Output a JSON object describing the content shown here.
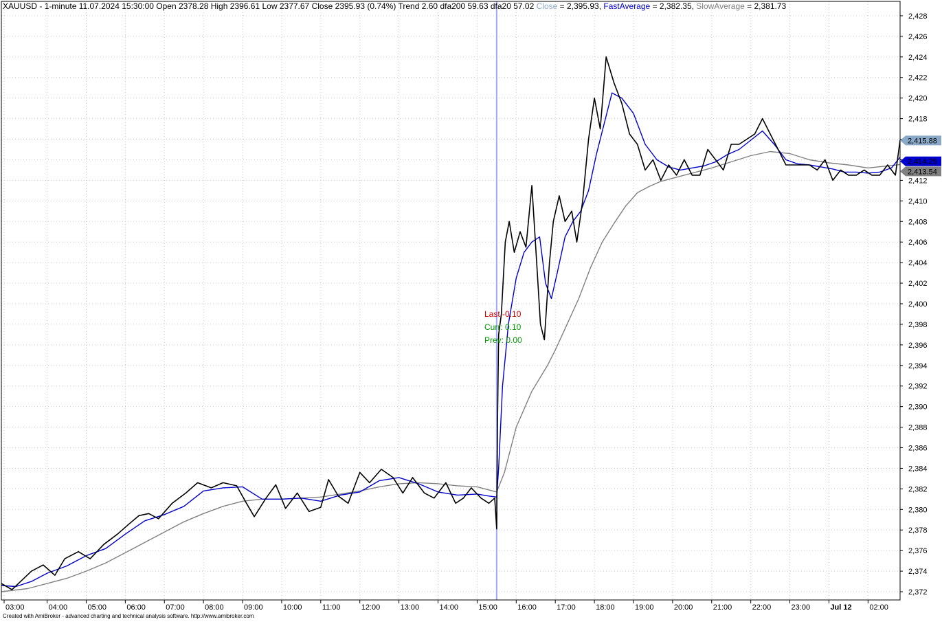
{
  "header": {
    "symbol": "XAUUSD",
    "interval": "1-minute",
    "datetime": "11.07.2024 15:30:00",
    "open_label": "Open",
    "open": "2378.28",
    "high_label": "High",
    "high": "2396.61",
    "low_label": "Low",
    "low": "2377.67",
    "close_label": "Close",
    "close": "2395.93",
    "change": "(0.74%)",
    "trend_label": "Trend",
    "trend": "2.60",
    "dfa200_label": "dfa200",
    "dfa200": "59.63",
    "dfa20_label": "dfa20",
    "dfa20": "57.02",
    "ind_close_label": "Close",
    "ind_close_value": "= 2,395.93",
    "ind_fast_label": "FastAverage",
    "ind_fast_value": "= 2,382.35",
    "ind_slow_label": "SlowAverage",
    "ind_slow_value": "= 2,381.73"
  },
  "annotations": {
    "last": "Last -0.10",
    "curr": "Curr: 0.10",
    "prev": "Prev: 0.00"
  },
  "footer": "Created with AmiBroker - advanced charting and technical analysis software. http://www.amibroker.com",
  "colors": {
    "price": "#000000",
    "fast": "#0000cc",
    "slow": "#808080",
    "cursor": "#a0a8ff",
    "grid": "#c8c8c8",
    "last_label": "#cc0000",
    "curr_label": "#009900",
    "prev_label": "#009900",
    "close_badge": "#8aa8c8",
    "fast_badge": "#0000cc",
    "slow_badge": "#808080"
  },
  "chart_data": {
    "type": "line",
    "x_tick_labels": [
      "03:00",
      "04:00",
      "05:00",
      "06:00",
      "07:00",
      "08:00",
      "09:00",
      "10:00",
      "11:00",
      "12:00",
      "13:00",
      "14:00",
      "15:00",
      "16:00",
      "17:00",
      "18:00",
      "19:00",
      "20:00",
      "21:00",
      "22:00",
      "23:00",
      "Jul 12",
      "02:00"
    ],
    "x_ticks": [
      2.9,
      4,
      5,
      6,
      7,
      8,
      9,
      10,
      11,
      12,
      13,
      14,
      15,
      16,
      17,
      18,
      19,
      20,
      21,
      22,
      23,
      24,
      25
    ],
    "xlim": [
      2.83,
      25.82
    ],
    "ylim": [
      2371.2,
      2429.4
    ],
    "y_ticks": [
      2372,
      2374,
      2376,
      2378,
      2380,
      2382,
      2384,
      2386,
      2388,
      2390,
      2392,
      2394,
      2396,
      2398,
      2400,
      2402,
      2404,
      2406,
      2408,
      2410,
      2412,
      2414,
      2416,
      2418,
      2420,
      2422,
      2424,
      2426,
      2428
    ],
    "y_tick_labels": [
      "2,372",
      "2,374",
      "2,376",
      "2,378",
      "2,380",
      "2,382",
      "2,384",
      "2,386",
      "2,388",
      "2,390",
      "2,392",
      "2,394",
      "2,396",
      "2,398",
      "2,400",
      "2,402",
      "2,404",
      "2,406",
      "2,408",
      "2,410",
      "2,412",
      "2,414",
      "2,416",
      "2,418",
      "2,420",
      "2,422",
      "2,424",
      "2,426",
      "2,428"
    ],
    "cursor_x": 15.5,
    "last_values": [
      {
        "name": "Close",
        "value": "2,415.88",
        "y": 2415.88
      },
      {
        "name": "FastAverage",
        "value": "2,414.25",
        "y": 2414.25
      },
      {
        "name": "SlowAverage",
        "value": "2,413.54",
        "y": 2413.54
      }
    ],
    "series": [
      {
        "name": "Close",
        "color": "#000000",
        "x": [
          2.83,
          3.1,
          3.35,
          3.6,
          3.9,
          4.2,
          4.45,
          4.8,
          5.1,
          5.45,
          5.8,
          6.1,
          6.35,
          6.6,
          6.85,
          7.2,
          7.55,
          7.85,
          8.2,
          8.5,
          8.85,
          9.1,
          9.3,
          9.6,
          9.85,
          10.1,
          10.4,
          10.7,
          11.0,
          11.2,
          11.45,
          11.7,
          12.0,
          12.25,
          12.55,
          12.85,
          13.1,
          13.35,
          13.65,
          13.9,
          14.2,
          14.45,
          14.65,
          14.85,
          15.1,
          15.3,
          15.45,
          15.5,
          15.52,
          15.55,
          15.62,
          15.72,
          15.82,
          15.95,
          16.1,
          16.25,
          16.4,
          16.5,
          16.62,
          16.72,
          16.85,
          16.95,
          17.1,
          17.25,
          17.42,
          17.55,
          17.7,
          17.85,
          18.0,
          18.15,
          18.3,
          18.5,
          18.7,
          18.9,
          19.1,
          19.3,
          19.5,
          19.7,
          19.9,
          20.1,
          20.3,
          20.5,
          20.7,
          20.9,
          21.1,
          21.3,
          21.5,
          21.7,
          21.9,
          22.1,
          22.3,
          22.5,
          22.7,
          22.9,
          23.1,
          23.3,
          23.5,
          23.7,
          23.9,
          24.1,
          24.3,
          24.5,
          24.7,
          24.9,
          25.1,
          25.3,
          25.5,
          25.7,
          25.82
        ],
        "y": [
          2372.8,
          2372.2,
          2373.1,
          2374.0,
          2374.6,
          2373.6,
          2375.2,
          2375.9,
          2375.2,
          2376.6,
          2377.6,
          2378.6,
          2379.4,
          2379.6,
          2379.1,
          2380.6,
          2381.6,
          2382.6,
          2382.1,
          2382.6,
          2382.3,
          2380.6,
          2379.3,
          2381.1,
          2382.4,
          2380.1,
          2381.6,
          2379.8,
          2380.2,
          2382.9,
          2381.3,
          2380.6,
          2383.6,
          2382.6,
          2383.9,
          2383.1,
          2381.6,
          2383.1,
          2381.6,
          2381.1,
          2382.6,
          2380.6,
          2381.1,
          2382.1,
          2381.1,
          2380.6,
          2381.1,
          2378.1,
          2388.0,
          2397.0,
          2399.0,
          2406.0,
          2408.0,
          2405.0,
          2407.0,
          2405.5,
          2411.5,
          2405.5,
          2398.0,
          2396.5,
          2404.0,
          2408.0,
          2410.5,
          2408.0,
          2409.0,
          2406.0,
          2410.0,
          2416.0,
          2420.0,
          2417.0,
          2424.0,
          2421.5,
          2419.5,
          2416.5,
          2415.5,
          2413.0,
          2414.0,
          2412.0,
          2413.5,
          2412.5,
          2414.0,
          2412.5,
          2412.5,
          2415.0,
          2414.0,
          2413.0,
          2415.5,
          2415.5,
          2416.0,
          2416.5,
          2418.0,
          2416.5,
          2415.0,
          2413.5,
          2413.5,
          2413.5,
          2413.5,
          2413.0,
          2414.0,
          2412.0,
          2413.0,
          2412.5,
          2412.5,
          2413.0,
          2412.5,
          2412.5,
          2413.5,
          2412.5,
          2415.9
        ]
      },
      {
        "name": "FastAverage",
        "color": "#0000cc",
        "x": [
          2.83,
          3.2,
          3.6,
          4.0,
          4.5,
          5.0,
          5.5,
          6.0,
          6.5,
          7.0,
          7.5,
          8.0,
          8.5,
          9.0,
          9.5,
          10.0,
          10.5,
          11.0,
          11.5,
          12.0,
          12.5,
          13.0,
          13.5,
          14.0,
          14.5,
          15.0,
          15.3,
          15.5,
          15.55,
          15.65,
          15.8,
          16.0,
          16.2,
          16.4,
          16.6,
          16.75,
          16.9,
          17.05,
          17.25,
          17.45,
          17.65,
          17.85,
          18.05,
          18.25,
          18.45,
          18.7,
          19.0,
          19.3,
          19.6,
          19.9,
          20.2,
          20.5,
          20.8,
          21.1,
          21.4,
          21.7,
          22.0,
          22.3,
          22.6,
          22.9,
          23.2,
          23.5,
          23.8,
          24.1,
          24.4,
          24.7,
          25.0,
          25.3,
          25.6,
          25.82
        ],
        "y": [
          2372.6,
          2372.5,
          2373.0,
          2373.8,
          2374.5,
          2375.5,
          2376.2,
          2377.6,
          2378.9,
          2379.5,
          2380.3,
          2381.8,
          2382.1,
          2382.2,
          2381.0,
          2381.0,
          2381.1,
          2380.8,
          2381.4,
          2381.7,
          2382.8,
          2383.1,
          2382.5,
          2381.7,
          2381.4,
          2381.5,
          2381.3,
          2381.2,
          2384.0,
          2392.0,
          2398.0,
          2402.5,
          2405.0,
          2406.0,
          2406.5,
          2402.0,
          2400.5,
          2403.0,
          2406.5,
          2408.0,
          2409.0,
          2411.0,
          2414.5,
          2417.5,
          2420.5,
          2420.0,
          2418.5,
          2415.5,
          2414.0,
          2413.3,
          2413.0,
          2413.2,
          2413.4,
          2413.8,
          2414.5,
          2415.0,
          2415.9,
          2416.8,
          2415.5,
          2414.0,
          2413.6,
          2413.5,
          2413.3,
          2413.1,
          2412.8,
          2412.8,
          2412.7,
          2412.8,
          2413.2,
          2414.25
        ]
      },
      {
        "name": "SlowAverage",
        "color": "#808080",
        "x": [
          2.83,
          3.5,
          4.0,
          4.5,
          5.0,
          5.5,
          6.0,
          6.5,
          7.0,
          7.5,
          8.0,
          8.5,
          9.0,
          9.5,
          10.0,
          10.5,
          11.0,
          11.5,
          12.0,
          12.5,
          13.0,
          13.5,
          14.0,
          14.5,
          15.0,
          15.3,
          15.5,
          15.7,
          16.0,
          16.4,
          16.8,
          17.0,
          17.3,
          17.6,
          17.9,
          18.2,
          18.5,
          18.8,
          19.1,
          19.4,
          19.7,
          20.0,
          20.5,
          21.0,
          21.5,
          22.0,
          22.5,
          23.0,
          23.5,
          24.0,
          24.5,
          25.0,
          25.5,
          25.82
        ],
        "y": [
          2372.0,
          2372.3,
          2372.8,
          2373.3,
          2374.0,
          2374.8,
          2375.8,
          2376.8,
          2377.8,
          2378.8,
          2379.6,
          2380.3,
          2380.8,
          2381.0,
          2381.0,
          2381.1,
          2381.2,
          2381.5,
          2381.8,
          2382.2,
          2382.5,
          2382.6,
          2382.5,
          2382.3,
          2382.2,
          2381.9,
          2381.7,
          2383.6,
          2388.0,
          2391.5,
          2394.0,
          2395.5,
          2398.0,
          2400.5,
          2403.5,
          2406.0,
          2407.8,
          2409.5,
          2410.8,
          2411.4,
          2411.9,
          2412.2,
          2412.7,
          2413.2,
          2413.8,
          2414.4,
          2414.8,
          2414.6,
          2414.0,
          2413.7,
          2413.5,
          2413.2,
          2413.4,
          2413.54
        ]
      }
    ]
  }
}
